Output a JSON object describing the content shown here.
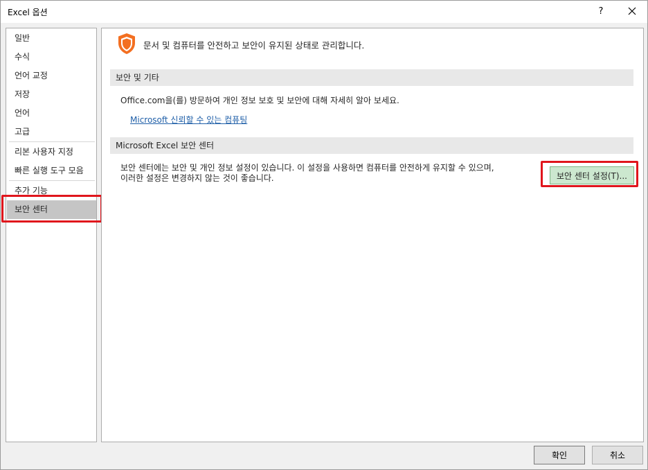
{
  "window": {
    "title": "Excel 옵션",
    "help_label": "?"
  },
  "sidebar": {
    "items": [
      {
        "label": "일반"
      },
      {
        "label": "수식"
      },
      {
        "label": "언어 교정"
      },
      {
        "label": "저장"
      },
      {
        "label": "언어"
      },
      {
        "label": "고급"
      },
      {
        "label": "리본 사용자 지정"
      },
      {
        "label": "빠른 실행 도구 모음"
      },
      {
        "label": "추가 기능"
      },
      {
        "label": "보안 센터"
      }
    ],
    "selected": "보안 센터"
  },
  "main": {
    "header_text": "문서 및 컴퓨터를 안전하고 보안이 유지된 상태로 관리합니다.",
    "sections": [
      {
        "title": "보안 및 기타",
        "text": "Office.com을(를) 방문하여 개인 정보 보호 및 보안에 대해 자세히 알아 보세요.",
        "link": "Microsoft 신뢰할 수 있는 컴퓨팅"
      },
      {
        "title": "Microsoft Excel 보안 센터",
        "text_line1": "보안 센터에는 보안 및 개인 정보 설정이 있습니다. 이 설정을 사용하면 컴퓨터를 안전하게 유지할 수 있으며,",
        "text_line2": "이러한 설정은 변경하지 않는 것이 좋습니다.",
        "button_label": "보안 센터 설정(T)..."
      }
    ]
  },
  "footer": {
    "ok_label": "확인",
    "cancel_label": "취소"
  },
  "colors": {
    "highlight": "#e0151c",
    "shield_orange": "#f36f21",
    "link_blue": "#1f5fa8",
    "button_green": "#cce8cf"
  }
}
